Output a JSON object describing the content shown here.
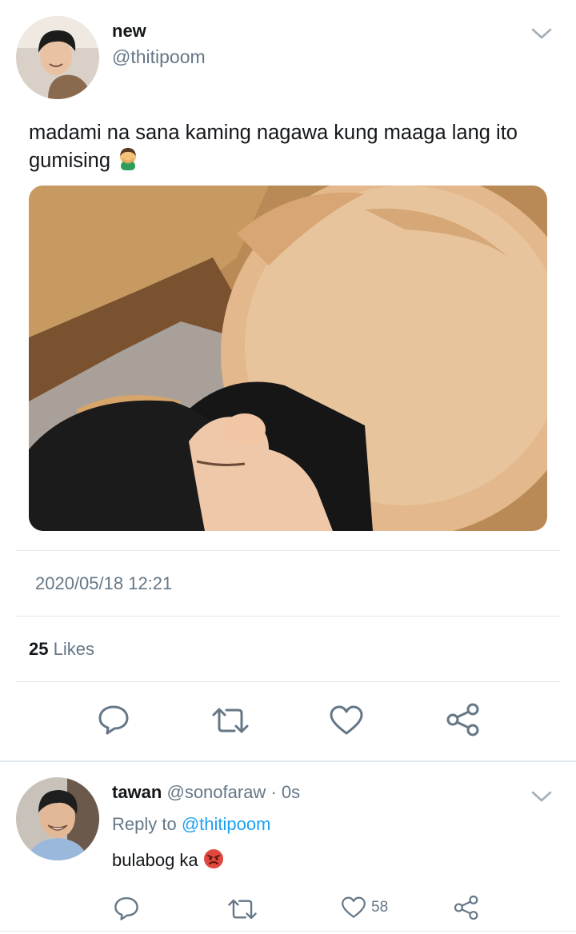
{
  "tweet": {
    "author_name": "new",
    "author_handle": "@thitipoom",
    "text": "madami na sana kaming nagawa kung maaga lang ito gumising",
    "text_emoji": "man-facepalming-emoji",
    "timestamp": "2020/05/18 12:21",
    "likes_count": "25",
    "likes_label": "Likes"
  },
  "reply": {
    "author_name": "tawan",
    "author_handle": "@sonofaraw",
    "age": "· 0s",
    "reply_prefix": "Reply to",
    "reply_target": "@thitipoom",
    "text": "bulabog ka",
    "text_emoji": "angry-face-emoji",
    "like_count": "58"
  },
  "icons": [
    "chevron-down-icon",
    "reply-icon",
    "retweet-icon",
    "heart-icon",
    "share-icon"
  ],
  "colors": {
    "primary_text": "#14171a",
    "secondary_text": "#657786",
    "link": "#1da1f2",
    "divider": "#e1e8ed"
  }
}
